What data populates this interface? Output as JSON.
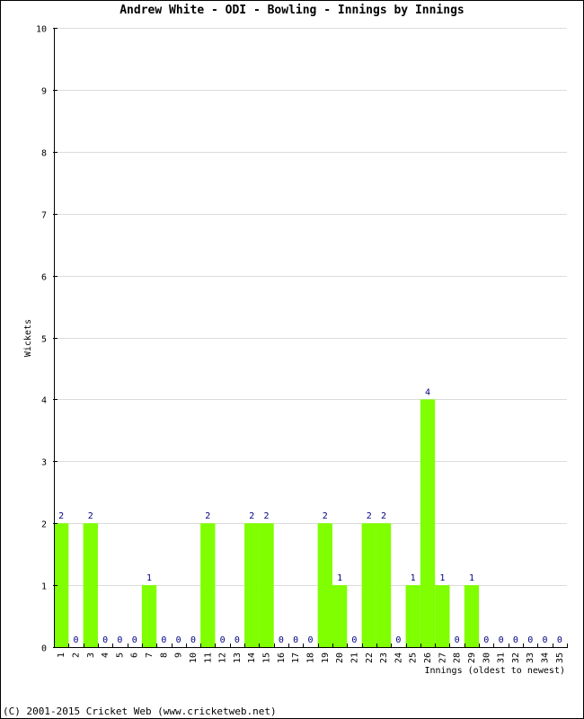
{
  "chart_data": {
    "type": "bar",
    "title": "Andrew White - ODI - Bowling - Innings by Innings",
    "xlabel": "Innings (oldest to newest)",
    "ylabel": "Wickets",
    "ylim": [
      0,
      10
    ],
    "yticks": [
      0,
      1,
      2,
      3,
      4,
      5,
      6,
      7,
      8,
      9,
      10
    ],
    "grid": true,
    "bar_color": "#7fff00",
    "value_label_color": "#000080",
    "categories": [
      "1",
      "2",
      "3",
      "4",
      "5",
      "6",
      "7",
      "8",
      "9",
      "10",
      "11",
      "12",
      "13",
      "14",
      "15",
      "16",
      "17",
      "18",
      "19",
      "20",
      "21",
      "22",
      "23",
      "24",
      "25",
      "26",
      "27",
      "28",
      "29",
      "30",
      "31",
      "32",
      "33",
      "34",
      "35"
    ],
    "values": [
      2,
      0,
      2,
      0,
      0,
      0,
      1,
      0,
      0,
      0,
      2,
      0,
      0,
      2,
      2,
      0,
      0,
      0,
      2,
      1,
      0,
      2,
      2,
      0,
      1,
      4,
      1,
      0,
      1,
      0,
      0,
      0,
      0,
      0,
      0
    ]
  },
  "footer": "(C) 2001-2015 Cricket Web (www.cricketweb.net)"
}
